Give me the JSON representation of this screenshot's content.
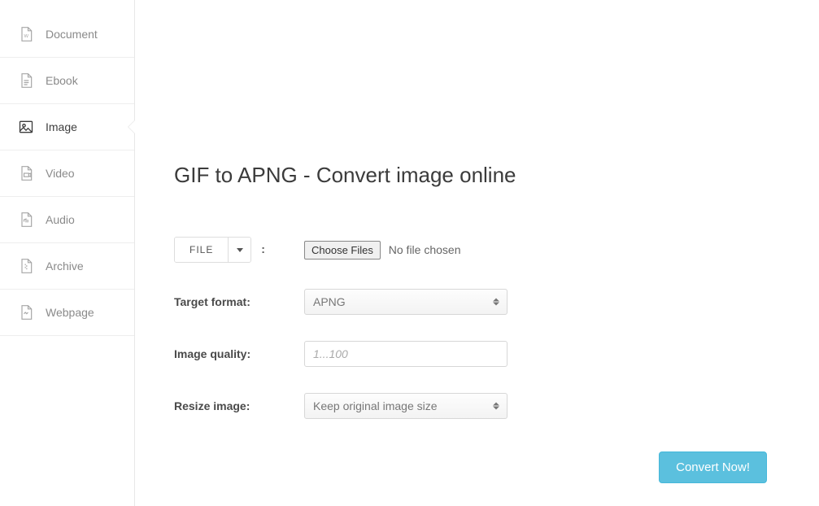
{
  "sidebar": {
    "items": [
      {
        "label": "Document",
        "icon": "document-icon",
        "active": false
      },
      {
        "label": "Ebook",
        "icon": "ebook-icon",
        "active": false
      },
      {
        "label": "Image",
        "icon": "image-icon",
        "active": true
      },
      {
        "label": "Video",
        "icon": "video-icon",
        "active": false
      },
      {
        "label": "Audio",
        "icon": "audio-icon",
        "active": false
      },
      {
        "label": "Archive",
        "icon": "archive-icon",
        "active": false
      },
      {
        "label": "Webpage",
        "icon": "webpage-icon",
        "active": false
      }
    ]
  },
  "page": {
    "title": "GIF to APNG - Convert image online"
  },
  "form": {
    "file_button_label": "FILE",
    "choose_files_label": "Choose Files",
    "no_file_text": "No file chosen",
    "target_format_label": "Target format:",
    "target_format_value": "APNG",
    "image_quality_label": "Image quality:",
    "image_quality_placeholder": "1...100",
    "resize_label": "Resize image:",
    "resize_value": "Keep original image size",
    "convert_button_label": "Convert Now!"
  }
}
